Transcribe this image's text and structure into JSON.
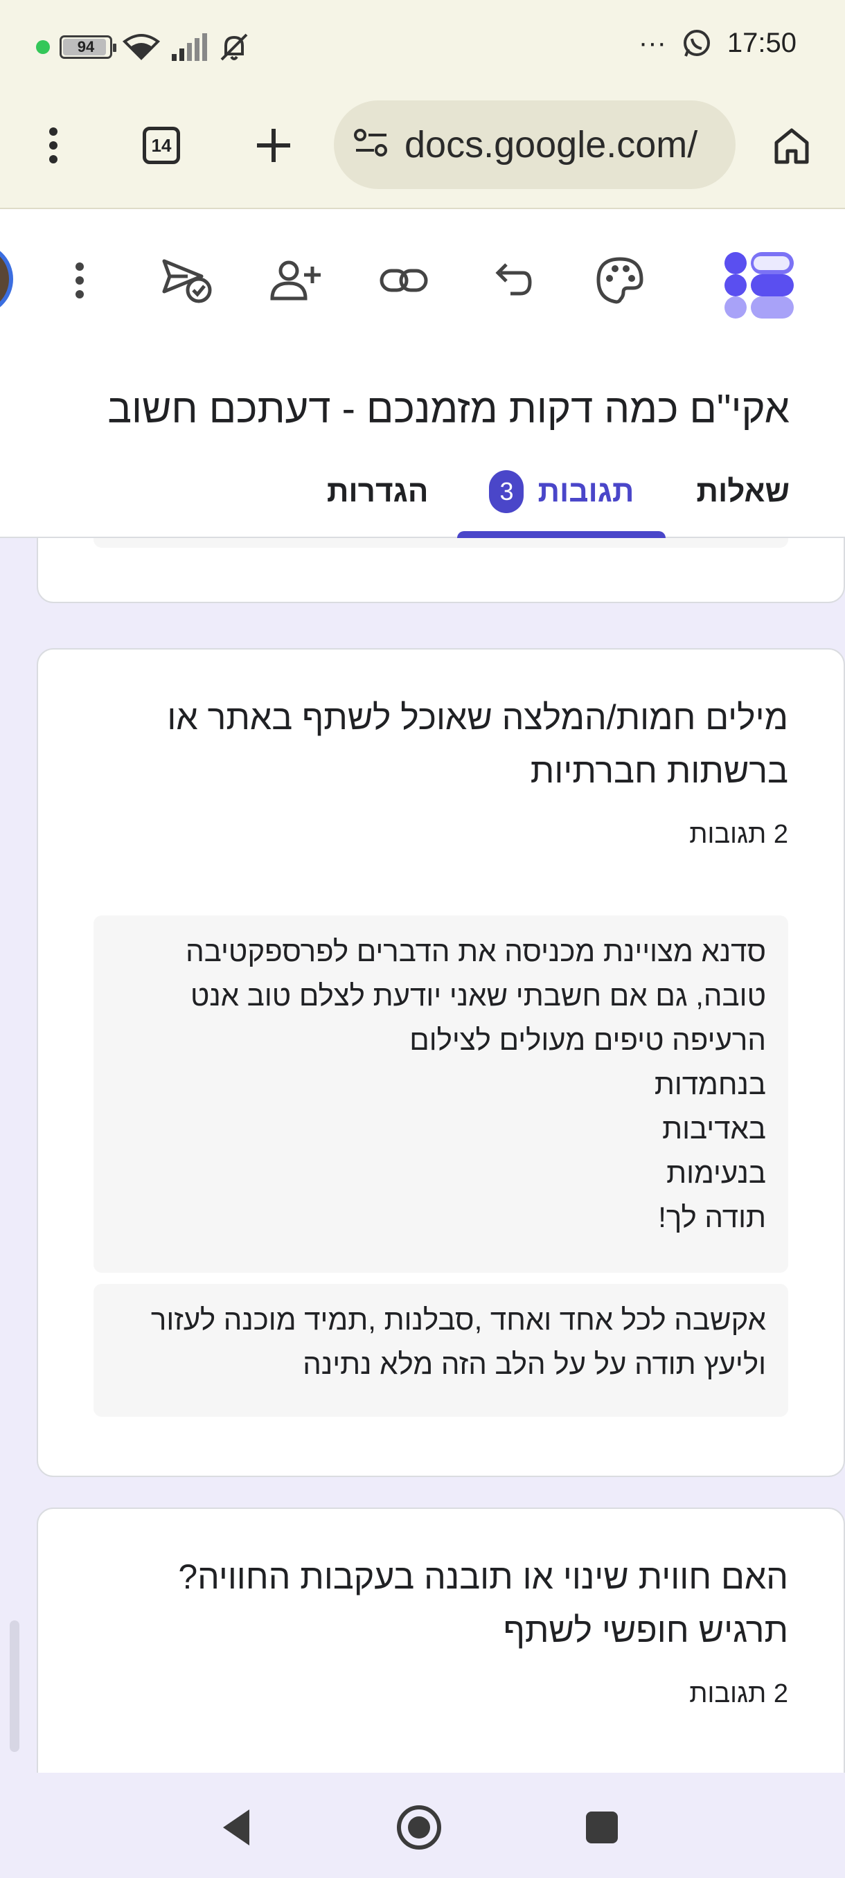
{
  "status_bar": {
    "battery": "94",
    "battery_level": 0.94,
    "time": "17:50",
    "more": "···"
  },
  "browser": {
    "url": "docs.google.com/",
    "tab_count": "14"
  },
  "form": {
    "title": "אקי\"ם כמה דקות מזמנכם - דעתכם חשוב",
    "tabs": {
      "questions": "שאלות",
      "responses": "תגובות",
      "responses_badge": "3",
      "settings": "הגדרות"
    }
  },
  "cards": [
    {
      "question": "מילים חמות/המלצה שאוכל לשתף באתר או ברשתות חברתיות",
      "response_count": "2 תגובות",
      "responses": [
        "סדנא מצויינת מכניסה את הדברים לפרספקטיבה טובה, גם אם חשבתי שאני יודעת לצלם טוב אנט הרעיפה טיפים מעולים לצילום\nבנחמדות\nבאדיבות\nבנעימות\nתודה לך!",
        "אקשבה לכל אחד ואחד ,סבלנות ,תמיד מוכנה לעזור וליעץ תודה על על הלב הזה מלא נתינה"
      ]
    },
    {
      "question": "האם חווית שינוי או תובנה בעקבות החוויה? תרגיש חופשי לשתף",
      "response_count": "2 תגובות"
    }
  ],
  "colors": {
    "accent": "#4a46c9",
    "background": "#eeecfa",
    "chrome": "#f5f4e6"
  }
}
